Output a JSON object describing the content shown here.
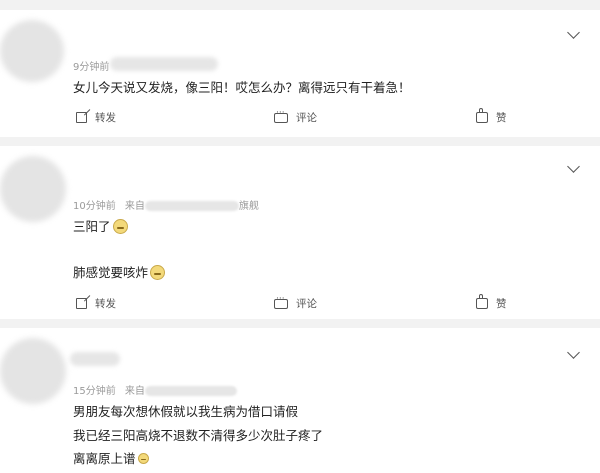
{
  "comments": [
    {
      "time": "9分钟前",
      "source_prefix": "",
      "source_suffix": "",
      "lines": [
        "女儿今天说又发烧，像三阳！哎怎么办？离得远只有干着急！"
      ],
      "actions": {
        "share": "转发",
        "comment": "评论",
        "like": "赞"
      }
    },
    {
      "time": "10分钟前",
      "source_prefix": "来自",
      "source_suffix": "旗舰",
      "lines": [
        "三阳了",
        "肺感觉要咳炸"
      ],
      "actions": {
        "share": "转发",
        "comment": "评论",
        "like": "赞"
      }
    },
    {
      "time": "15分钟前",
      "source_prefix": "来自",
      "source_suffix": "",
      "lines": [
        "男朋友每次想休假就以我生病为借口请假",
        "我已经三阳高烧不退数不清得多少次肚子疼了",
        "离离原上谱"
      ]
    }
  ],
  "icons": {
    "expand": "chevron-down-icon",
    "share": "share-icon",
    "comment": "comment-icon",
    "like": "thumbs-up-icon",
    "emoji": "emoji-icon"
  }
}
